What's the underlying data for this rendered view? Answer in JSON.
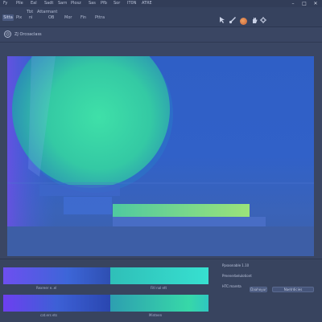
{
  "menu": {
    "items": [
      "Fy",
      "Pile",
      "Eal",
      "Sadt",
      "Sarn",
      "Plosz",
      "Sas",
      "Pfb",
      "Sor",
      "IT0N",
      "ATRE"
    ],
    "win_buttons": [
      "–",
      "□",
      "✕"
    ]
  },
  "toolbar": {
    "tab_label": "Sitta",
    "labels": [
      "Pix",
      "ni",
      "OB",
      "Mor",
      "Fin",
      "Pttra"
    ],
    "row1_labels": [
      "Tbt",
      "Attarmant"
    ],
    "icons": [
      "cursor-icon",
      "brush-icon",
      "hand-icon",
      "settings-icon"
    ]
  },
  "address": {
    "icon": "◎",
    "text": "ZJ Orcoaclass"
  },
  "viewport": {
    "colors": {
      "sky": "#2f5fc6",
      "sphere": "#3ad6a6",
      "accent_purple": "#7b5cf0",
      "floor_bar": "#8fe07a"
    }
  },
  "panel": {
    "swatch_labels": [
      "Rexreer e..el",
      "Fitl nal ett",
      "cat.ers ets",
      "Minteen"
    ],
    "info": [
      "Ppsoonable 1.10",
      "Pmenerbelulotiont",
      "HTC:mareta"
    ],
    "controls": [
      "Daahoyur",
      "Naetrdicies"
    ]
  }
}
